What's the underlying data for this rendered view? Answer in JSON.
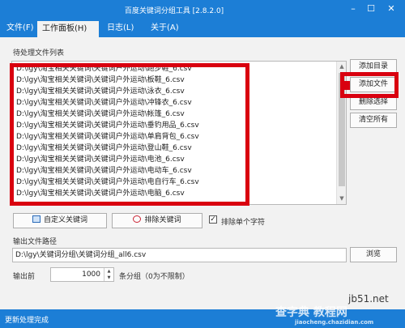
{
  "window": {
    "title": "百度关键词分组工具 [2.8.2.0]",
    "min": "–",
    "max": "☐",
    "close": "✕"
  },
  "menu": {
    "file": "文件(F)",
    "workpanel": "工作面板(H)",
    "log": "日志(L)",
    "about": "关于(A)"
  },
  "list": {
    "title": "待处理文件列表",
    "items": [
      "D:\\lgy\\淘宝相关关键词\\关键词户外运动\\跑步鞋_6.csv",
      "D:\\lgy\\淘宝相关关键词\\关键词户外运动\\板鞋_6.csv",
      "D:\\lgy\\淘宝相关关键词\\关键词户外运动\\泳衣_6.csv",
      "D:\\lgy\\淘宝相关关键词\\关键词户外运动\\冲锋衣_6.csv",
      "D:\\lgy\\淘宝相关关键词\\关键词户外运动\\帐篷_6.csv",
      "D:\\lgy\\淘宝相关关键词\\关键词户外运动\\垂钓用品_6.csv",
      "D:\\lgy\\淘宝相关关键词\\关键词户外运动\\单肩背包_6.csv",
      "D:\\lgy\\淘宝相关关键词\\关键词户外运动\\登山鞋_6.csv",
      "D:\\lgy\\淘宝相关关键词\\关键词户外运动\\电池_6.csv",
      "D:\\lgy\\淘宝相关关键词\\关键词户外运动\\电动车_6.csv",
      "D:\\lgy\\淘宝相关关键词\\关键词户外运动\\电自行车_6.csv",
      "D:\\lgy\\淘宝相关关键词\\关键词户外运动\\电脑_6.csv"
    ]
  },
  "buttons": {
    "add_dir": "添加目录",
    "add_file": "添加文件",
    "delete_sel": "删除选择",
    "clear_all": "清空所有",
    "custom_kw": "自定义关键词",
    "exclude_kw": "排除关键词",
    "browse": "浏览"
  },
  "exclude_single": {
    "label": "排除单个字符",
    "checked": "✓"
  },
  "output": {
    "label": "输出文件路径",
    "path": "D:\\lgy\\关键词分组\\关键词分组_all6.csv"
  },
  "top": {
    "label": "输出前",
    "value": "1000",
    "suffix": "条分组（0为不限制）"
  },
  "status": {
    "text": "更新处理完成"
  },
  "watermark": {
    "site": "jb51.net",
    "brand": "查字典 教程网",
    "url": "jiaocheng.chazidian.com"
  },
  "colors": {
    "chrome_blue": "#1c7ed6",
    "highlight_red": "#d9000f",
    "panel_gray": "#f2f2f2"
  }
}
